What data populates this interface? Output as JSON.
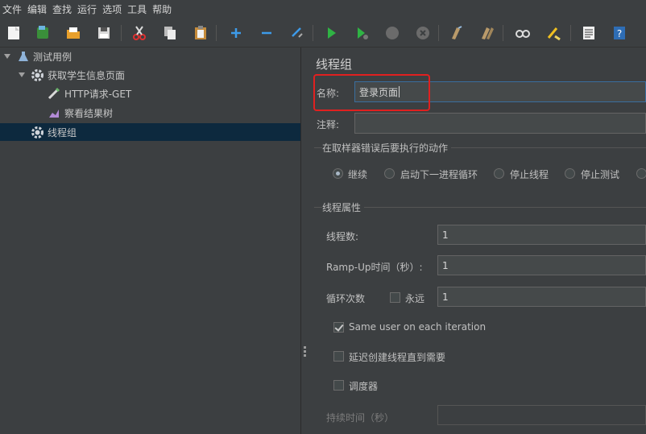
{
  "menu": [
    "文件",
    "编辑",
    "查找",
    "运行",
    "选项",
    "工具",
    "帮助"
  ],
  "toolbar": {
    "icons": [
      "new-icon",
      "templates-icon",
      "open-icon",
      "save-icon",
      "cut-icon",
      "copy-icon",
      "paste-icon",
      "expand-icon",
      "collapse-icon",
      "toggle-icon",
      "start-icon",
      "start-no-pause-icon",
      "stop-icon",
      "shutdown-icon",
      "clear-icon",
      "clear-all-icon",
      "search-icon",
      "reset-search-icon",
      "function-helper-icon",
      "help-icon"
    ]
  },
  "tree": {
    "items": [
      {
        "label": "测试用例",
        "icon": "test-plan-icon",
        "expanded": true
      },
      {
        "label": "获取学生信息页面",
        "icon": "gear-icon",
        "expanded": true
      },
      {
        "label": "HTTP请求-GET",
        "icon": "pipette-icon"
      },
      {
        "label": "察看结果树",
        "icon": "chart-icon"
      },
      {
        "label": "线程组",
        "icon": "gear-icon",
        "selected": true
      }
    ]
  },
  "panel": {
    "title": "线程组",
    "name_label": "名称:",
    "name_value": "登录页面",
    "comment_label": "注释:",
    "comment_value": "",
    "error_action": {
      "title": "在取样器错误后要执行的动作",
      "options": [
        "继续",
        "启动下一进程循环",
        "停止线程",
        "停止测试"
      ],
      "selected": "继续"
    },
    "thread_props": {
      "title": "线程属性",
      "threads_label": "线程数:",
      "threads_value": "1",
      "rampup_label": "Ramp-Up时间（秒）:",
      "rampup_value": "1",
      "loop_label": "循环次数",
      "forever_label": "永远",
      "forever_checked": false,
      "loop_value": "1",
      "same_user_label": "Same user on each iteration",
      "same_user_checked": true,
      "delay_label": "延迟创建线程直到需要",
      "delay_checked": false,
      "scheduler_label": "调度器",
      "scheduler_checked": false,
      "duration_label": "持续时间（秒）"
    }
  }
}
